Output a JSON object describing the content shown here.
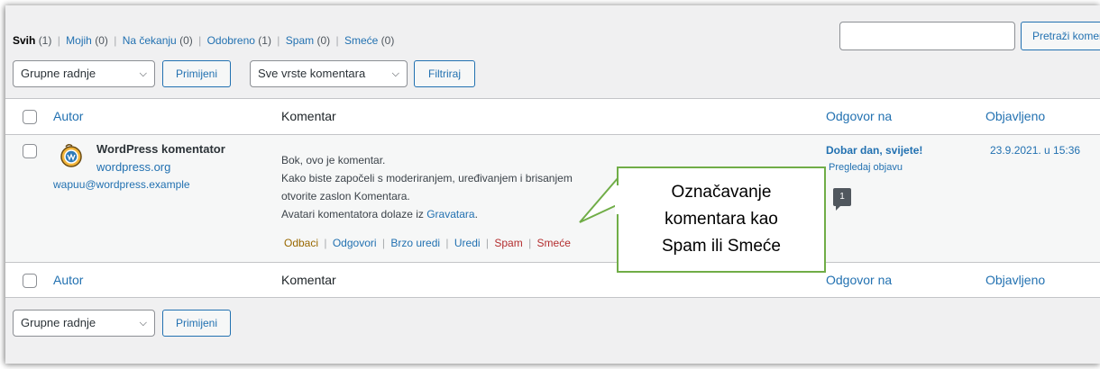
{
  "filters": {
    "links": [
      {
        "label": "Svih",
        "count": "(1)"
      },
      {
        "label": "Mojih",
        "count": "(0)"
      },
      {
        "label": "Na čekanju",
        "count": "(0)"
      },
      {
        "label": "Odobreno",
        "count": "(1)"
      },
      {
        "label": "Spam",
        "count": "(0)"
      },
      {
        "label": "Smeće",
        "count": "(0)"
      }
    ],
    "separator": "|"
  },
  "search": {
    "input_value": "",
    "button_label": "Pretraži komentare"
  },
  "top_actions": {
    "bulk_select": "Grupne radnje",
    "apply_label": "Primijeni",
    "type_select": "Sve vrste komentara",
    "filter_label": "Filtriraj"
  },
  "columns": {
    "author": "Autor",
    "comment": "Komentar",
    "response": "Odgovor na",
    "date": "Objavljeno"
  },
  "comment": {
    "author_name": "WordPress komentator",
    "author_url": "wordpress.org",
    "author_email": "wapuu@wordpress.example",
    "line1": "Bok, ovo je komentar.",
    "line2": "Kako biste započeli s moderiranjem, uređivanjem i brisanjem",
    "line3": "otvorite zaslon Komentara.",
    "line4_prefix": "Avatari komentatora dolaze iz ",
    "line4_link": "Gravatara",
    "line4_suffix": ".",
    "actions": {
      "unapprove": "Odbaci",
      "reply": "Odgovori",
      "quick_edit": "Brzo uredi",
      "edit": "Uredi",
      "spam": "Spam",
      "trash": "Smeće"
    },
    "response_title": "Dobar dan, svijete!",
    "response_view": "Pregledaj objavu",
    "response_count": "1",
    "date": "23.9.2021. u 15:36"
  },
  "bottom_actions": {
    "bulk_select": "Grupne radnje",
    "apply_label": "Primijeni"
  },
  "callout": {
    "line1": "Označavanje",
    "line2": "komentara kao",
    "line3": "Spam ili Smeće"
  },
  "colors": {
    "link": "#2271b1",
    "callout_border": "#70ad47",
    "trash_red": "#b32d2e",
    "unapprove_orange": "#996800"
  }
}
